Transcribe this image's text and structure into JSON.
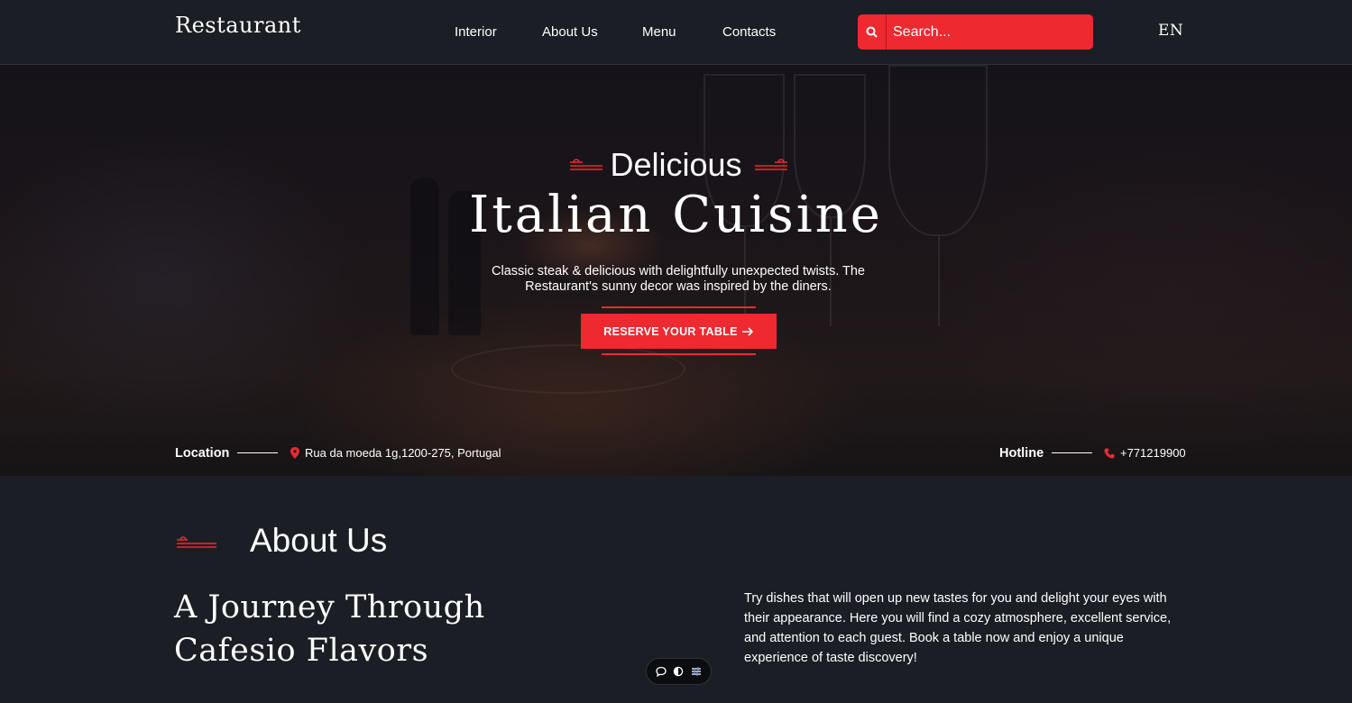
{
  "header": {
    "logo": "Restaurant",
    "nav": [
      {
        "label": "Interior"
      },
      {
        "label": "About Us"
      },
      {
        "label": "Menu"
      },
      {
        "label": "Contacts"
      }
    ],
    "search": {
      "placeholder": "Search...",
      "value": "",
      "icon": "search-icon"
    },
    "language": "EN"
  },
  "hero": {
    "eyebrow": "Delicious",
    "title": "Italian Cuisine",
    "description": "Classic steak & delicious with delightfully unexpected twists. The Restaurant's sunny decor was inspired by the diners.",
    "cta": {
      "label": "RESERVE YOUR TABLE",
      "icon": "arrow-right-icon"
    },
    "location": {
      "label": "Location",
      "icon": "map-pin-icon",
      "value": "Rua da moeda 1g,1200-275, Portugal"
    },
    "hotline": {
      "label": "Hotline",
      "icon": "phone-icon",
      "value": "+771219900"
    }
  },
  "about": {
    "section_title": "About Us",
    "heading": "A Journey Through Cafesio Flavors",
    "text": "Try dishes that will open up new tastes for you and delight your eyes with their appearance. Here you will find a cozy atmosphere, excellent service, and attention to each guest. Book a table now and enjoy a unique experience of taste discovery!"
  },
  "floating_toolbar": {
    "icons": [
      "chat-bubble-icon",
      "contrast-toggle-icon",
      "settings-sliders-icon"
    ]
  },
  "colors": {
    "accent": "#ee2a30",
    "background": "#1b1e24",
    "text": "#ffffff"
  }
}
